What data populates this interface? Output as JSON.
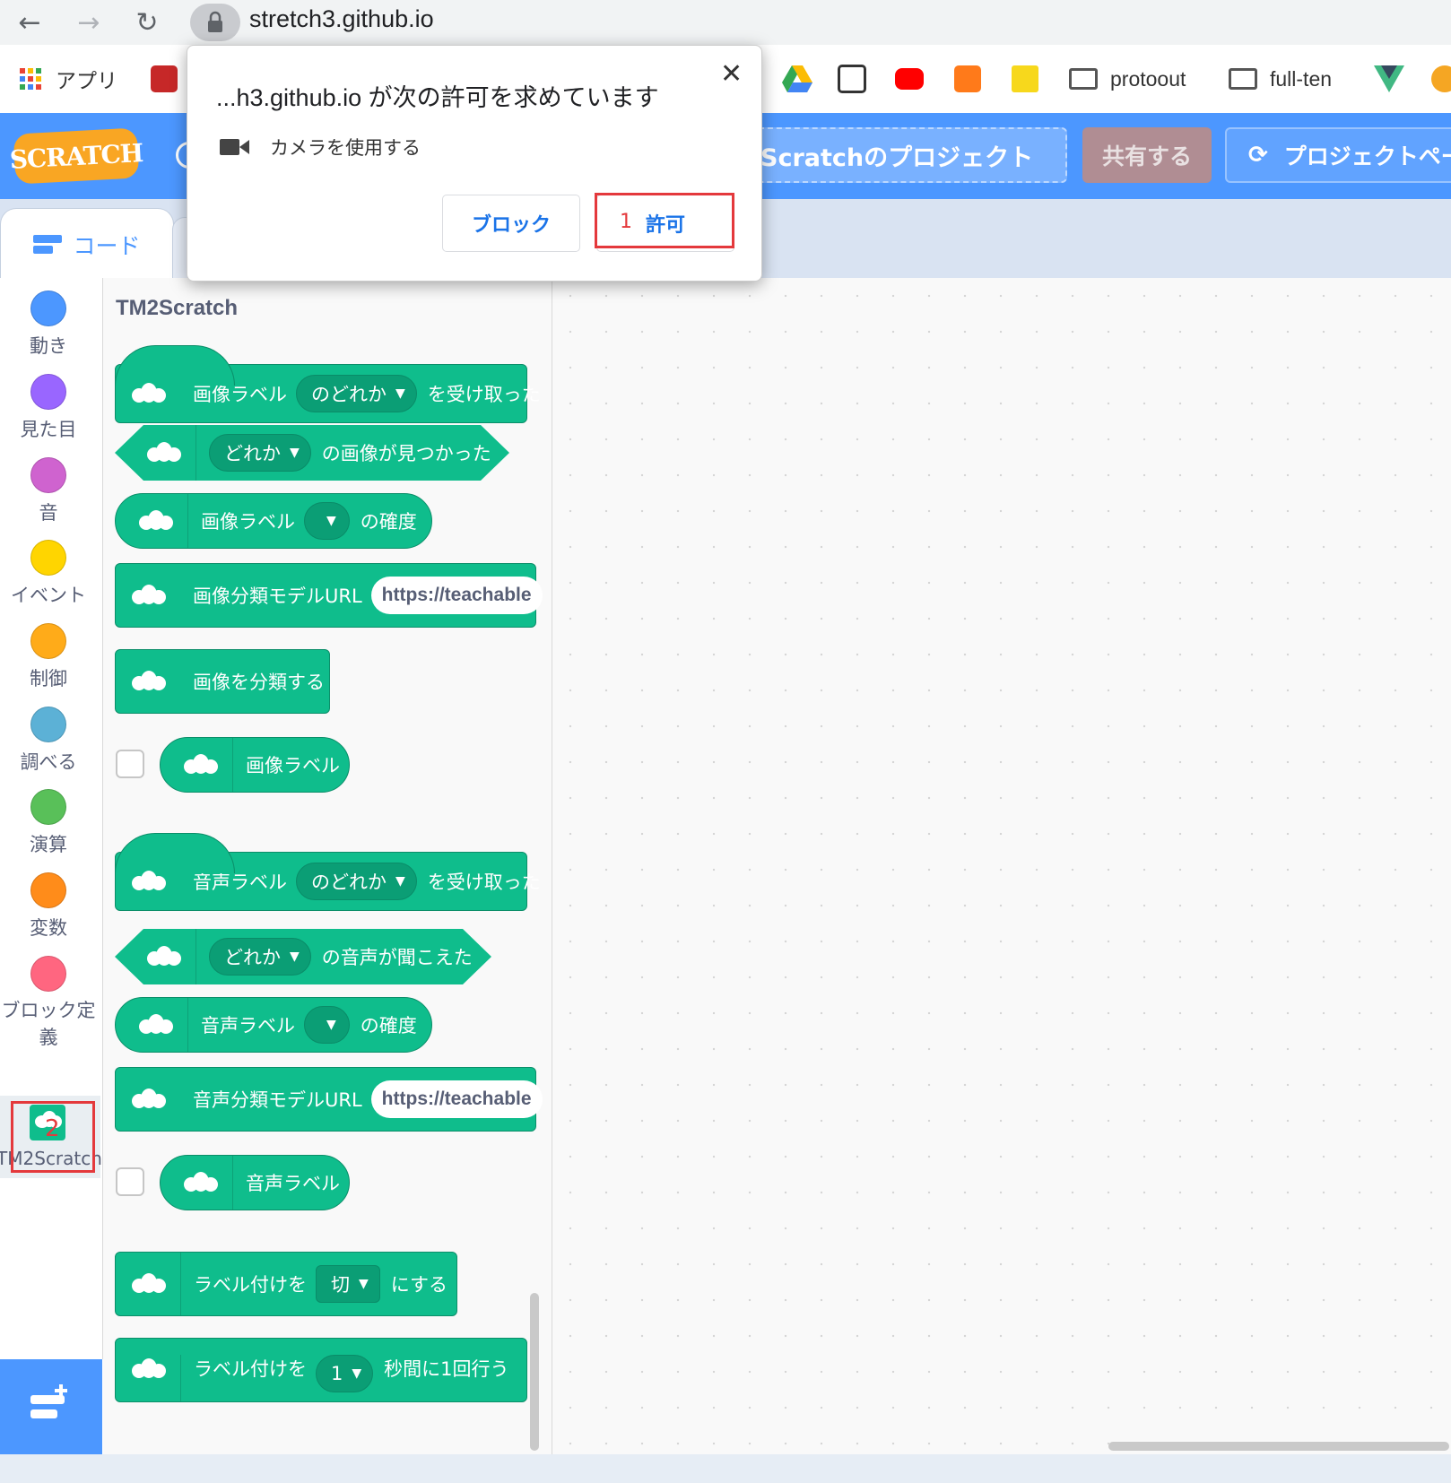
{
  "browser": {
    "url": "stretch3.github.io",
    "back_icon": "back-arrow-icon",
    "forward_icon": "forward-arrow-icon",
    "reload_icon": "reload-icon"
  },
  "bookmarks": {
    "apps_label": "アプリ",
    "protoout": "protoout",
    "fullten": "full-ten"
  },
  "menubar": {
    "logo": "SCRATCH",
    "project_title": "Scratchのプロジェクト",
    "share": "共有する",
    "project_page": "プロジェクトペー"
  },
  "tabs": {
    "code": "コード"
  },
  "categories": [
    {
      "label": "動き",
      "color": "#4c97ff"
    },
    {
      "label": "見た目",
      "color": "#9966ff"
    },
    {
      "label": "音",
      "color": "#cf63cf"
    },
    {
      "label": "イベント",
      "color": "#ffd500"
    },
    {
      "label": "制御",
      "color": "#ffab19"
    },
    {
      "label": "調べる",
      "color": "#5cb1d6"
    },
    {
      "label": "演算",
      "color": "#59c059"
    },
    {
      "label": "変数",
      "color": "#ff8c1a"
    },
    {
      "label": "ブロック定義",
      "color": "#ff6680"
    }
  ],
  "tm2": {
    "label": "TM2Scratch",
    "annotation": "2"
  },
  "palette": {
    "title": "TM2Scratch",
    "blocks": {
      "img_hat": {
        "pre": "画像ラベル",
        "dd": "のどれか",
        "post": "を受け取った"
      },
      "img_found": {
        "dd": "どれか",
        "post": "の画像が見つかった"
      },
      "img_conf": {
        "pre": "画像ラベル",
        "post": "の確度"
      },
      "img_model": {
        "pre": "画像分類モデルURL",
        "field": "https://teachable"
      },
      "img_classify": {
        "pre": "画像を分類する"
      },
      "img_label": {
        "pre": "画像ラベル"
      },
      "snd_hat": {
        "pre": "音声ラベル",
        "dd": "のどれか",
        "post": "を受け取った"
      },
      "snd_heard": {
        "dd": "どれか",
        "post": "の音声が聞こえた"
      },
      "snd_conf": {
        "pre": "音声ラベル",
        "post": "の確度"
      },
      "snd_model": {
        "pre": "音声分類モデルURL",
        "field": "https://teachable"
      },
      "snd_label": {
        "pre": "音声ラベル"
      },
      "labeling": {
        "pre": "ラベル付けを",
        "dd": "切",
        "post": "にする"
      },
      "labeling_interval": {
        "pre": "ラベル付けを",
        "dd": "1",
        "post": "秒間に1回行う"
      }
    }
  },
  "dialog": {
    "title": "...h3.github.io が次の許可を求めています",
    "permission": "カメラを使用する",
    "block": "ブロック",
    "allow": "許可",
    "annotation": "1"
  }
}
